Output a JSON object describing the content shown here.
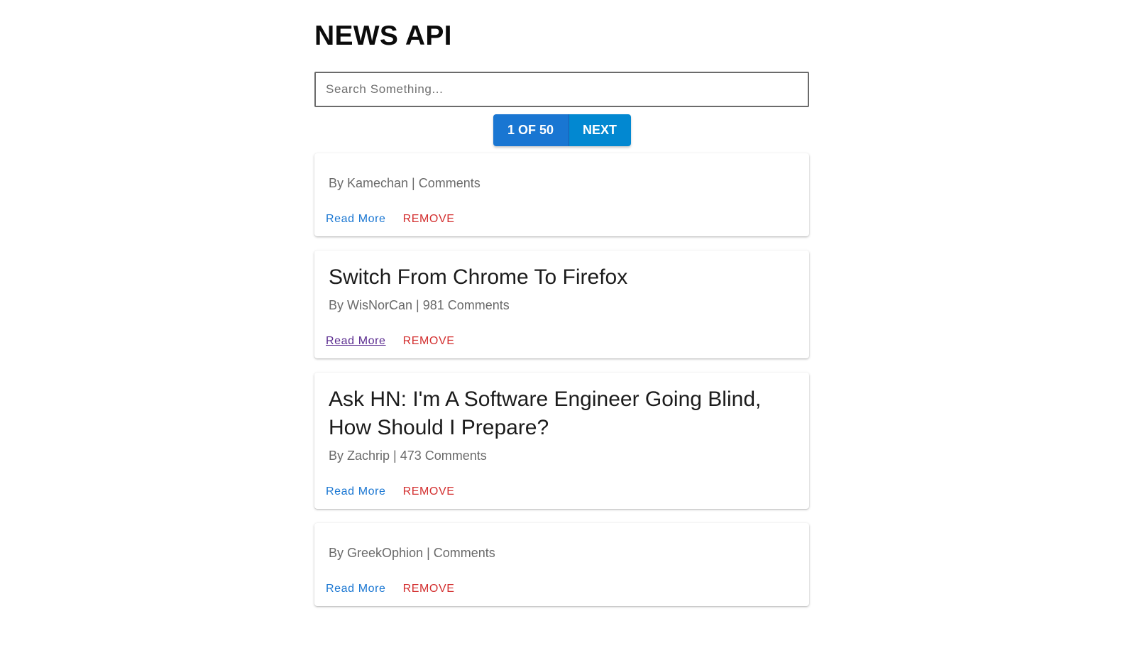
{
  "header": {
    "title": "NEWS API"
  },
  "search": {
    "placeholder": "Search Something...",
    "value": ""
  },
  "pager": {
    "count_label": "1 OF 50",
    "next_label": "NEXT"
  },
  "articles": [
    {
      "title": "",
      "meta": "By Kamechan | Comments",
      "read_more": "Read More",
      "remove": "REMOVE"
    },
    {
      "title": "Switch From Chrome To Firefox",
      "meta": "By WisNorCan | 981 Comments",
      "read_more": "Read More",
      "remove": "REMOVE"
    },
    {
      "title": "Ask HN: I'm A Software Engineer Going Blind, How Should I Prepare?",
      "meta": "By Zachrip | 473 Comments",
      "read_more": "Read More",
      "remove": "REMOVE"
    },
    {
      "title": "",
      "meta": "By GreekOphion | Comments",
      "read_more": "Read More",
      "remove": "REMOVE"
    }
  ],
  "colors": {
    "primary": "#1976d2",
    "next": "#0288d1",
    "remove": "#d32f2f",
    "visited_link": "#5a2b8f"
  }
}
